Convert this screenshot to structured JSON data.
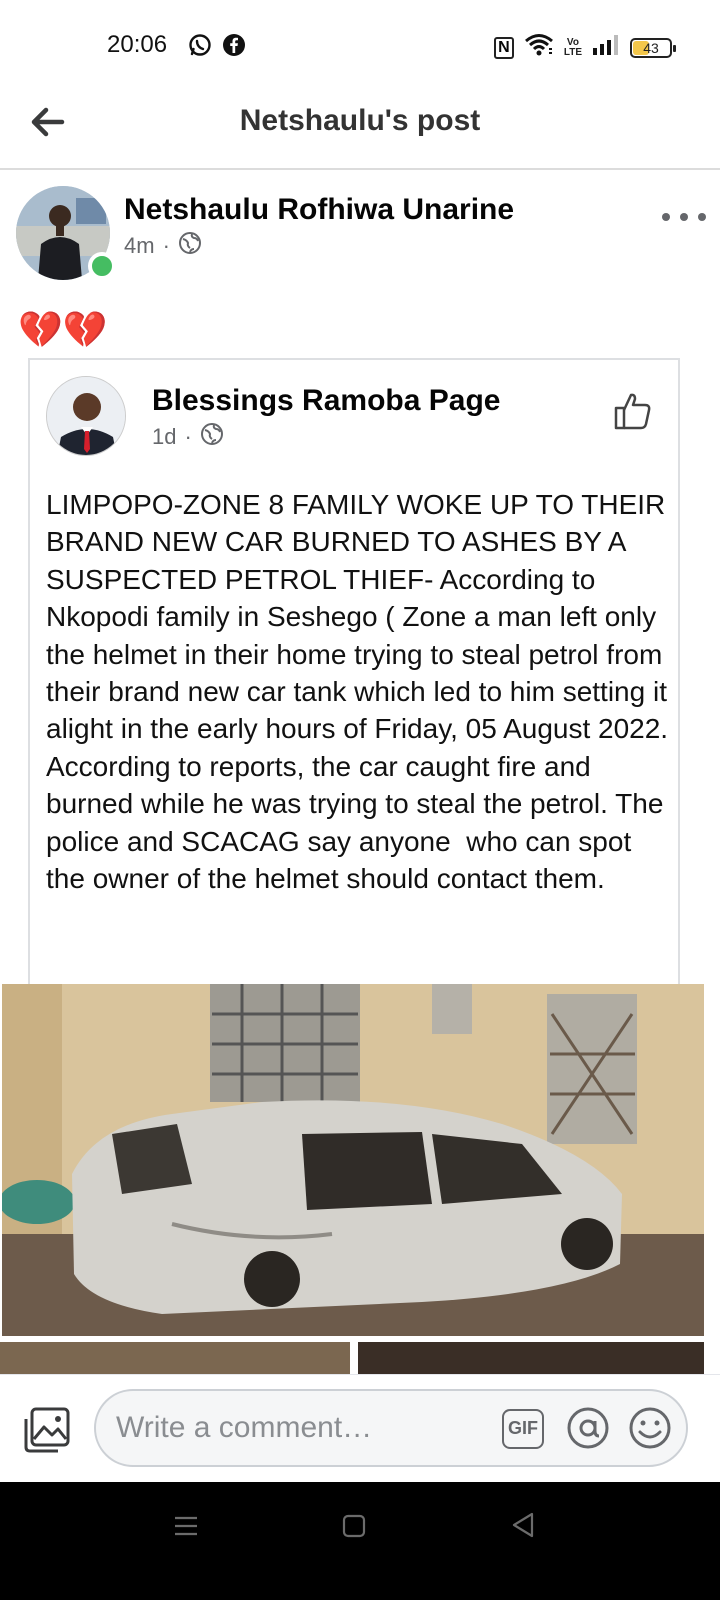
{
  "status_bar": {
    "time": "20:06",
    "left_icons": [
      "whatsapp-icon",
      "facebook-icon"
    ],
    "right_icons": [
      "nfc-icon",
      "wifi-icon",
      "volte-icon",
      "signal-icon",
      "battery-icon"
    ],
    "volte_text": "Vo\nLTE",
    "battery_level": "43",
    "battery_color": "#f3c74b"
  },
  "header": {
    "title": "Netshaulu's post",
    "back_icon": "arrow-left-icon"
  },
  "post": {
    "author_name": "Netshaulu Rofhiwa Unarine",
    "time": "4m",
    "separator": "·",
    "privacy_icon": "globe-icon",
    "online_color": "#45bd62",
    "content": "💔💔"
  },
  "shared_post": {
    "page_name": "Blessings Ramoba Page",
    "time": "1d",
    "separator": "·",
    "privacy_icon": "globe-icon",
    "like_icon": "thumbs-up-icon",
    "text": "LIMPOPO-ZONE 8 FAMILY WOKE UP TO THEIR BRAND NEW CAR BURNED TO ASHES BY A SUSPECTED PETROL THIEF- According to Nkopodi family in Seshego ( Zone a man left only the helmet in their home trying to steal petrol from their brand new car tank which led to him setting it alight in the early hours of Friday, 05 August 2022. According to reports, the car caught fire and burned while he was trying to steal the petrol. The police and SCACAG say anyone  who can spot the owner of the helmet should contact them."
  },
  "comment_bar": {
    "placeholder": "Write a comment…",
    "gif_label": "GIF",
    "photo_icon": "photo-icon",
    "mention_icon": "at-icon",
    "emoji_icon": "smiley-icon"
  },
  "nav_bar": {
    "icons": [
      "menu-icon",
      "home-square-icon",
      "back-triangle-icon"
    ]
  },
  "colors": {
    "text_primary": "#050505",
    "text_secondary": "#65676b",
    "divider": "#dcdcdc"
  }
}
